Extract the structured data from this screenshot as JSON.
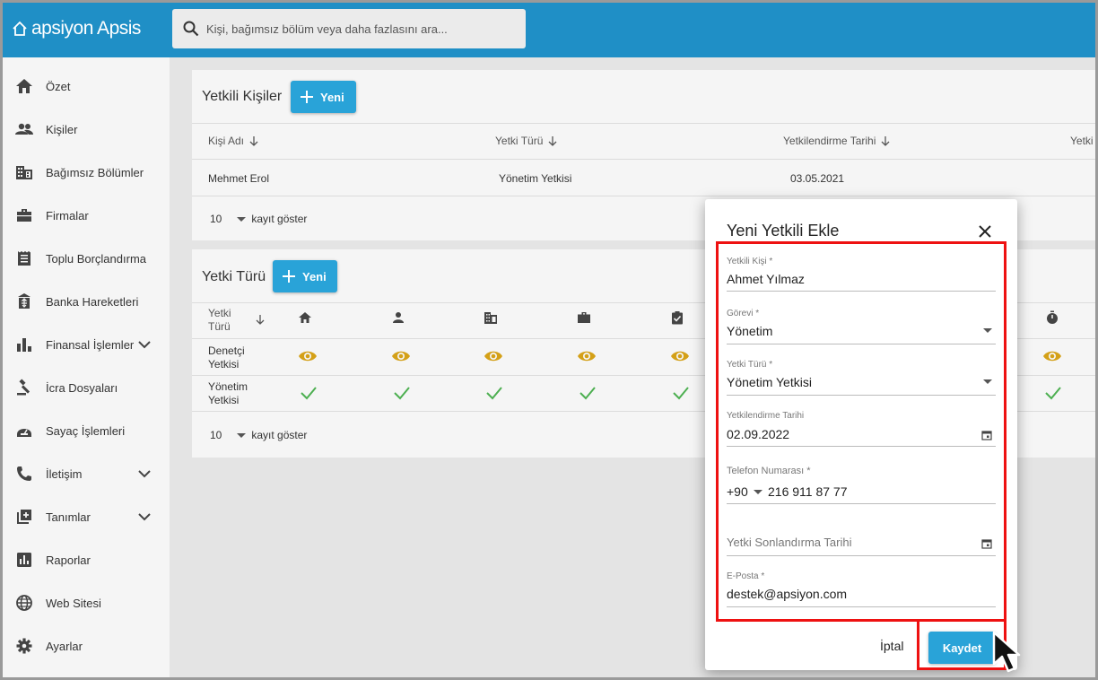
{
  "header": {
    "logo_text": "apsiyon Apsis",
    "search_placeholder": "Kişi, bağımsız bölüm veya daha fazlasını ara...",
    "color": "#1f8fc6"
  },
  "sidebar": {
    "items": [
      {
        "label": "Özet",
        "icon": "home-icon"
      },
      {
        "label": "Kişiler",
        "icon": "people-icon"
      },
      {
        "label": "Bağımsız Bölümler",
        "icon": "building-icon"
      },
      {
        "label": "Firmalar",
        "icon": "briefcase-icon"
      },
      {
        "label": "Toplu Borçlandırma",
        "icon": "receipt-icon"
      },
      {
        "label": "Banka Hareketleri",
        "icon": "bank-transfer-icon"
      },
      {
        "label": "Finansal İşlemler",
        "icon": "bar-chart-icon",
        "expandable": true
      },
      {
        "label": "İcra Dosyaları",
        "icon": "gavel-icon"
      },
      {
        "label": "Sayaç İşlemleri",
        "icon": "meter-icon"
      },
      {
        "label": "İletişim",
        "icon": "phone-icon",
        "expandable": true
      },
      {
        "label": "Tanımlar",
        "icon": "library-add-icon",
        "expandable": true
      },
      {
        "label": "Raporlar",
        "icon": "report-icon"
      },
      {
        "label": "Web Sitesi",
        "icon": "globe-icon"
      },
      {
        "label": "Ayarlar",
        "icon": "gear-icon"
      }
    ]
  },
  "yetkili": {
    "title": "Yetkili Kişiler",
    "new_label": "Yeni",
    "columns": [
      "Kişi Adı",
      "Yetki Türü",
      "Yetkilendirme Tarihi",
      "Yetki"
    ],
    "rows": [
      {
        "name": "Mehmet Erol",
        "type": "Yönetim Yetkisi",
        "date": "03.05.2021"
      }
    ],
    "page_size": "10",
    "page_label": "kayıt göster"
  },
  "yetki_turu": {
    "title": "Yetki Türü",
    "new_label": "Yeni",
    "col_header": "Yetki Türü",
    "col_icons": [
      "home-icon",
      "person-icon",
      "building-icon",
      "briefcase-icon",
      "clipboard-check-icon",
      "stopwatch-icon"
    ],
    "rows": [
      {
        "label": "Denetçi Yetkisi",
        "perm": "view"
      },
      {
        "label": "Yönetim Yetkisi",
        "perm": "edit"
      }
    ],
    "page_size": "10",
    "page_label": "kayıt göster",
    "eye_color": "#d4a017",
    "check_color": "#4caf50"
  },
  "modal": {
    "title": "Yeni Yetkili Ekle",
    "fields": {
      "person_label": "Yetkili Kişi *",
      "person_value": "Ahmet Yılmaz",
      "role_label": "Görevi *",
      "role_value": "Yönetim",
      "type_label": "Yetki Türü *",
      "type_value": "Yönetim Yetkisi",
      "date_label": "Yetkilendirme Tarihi",
      "date_value": "02.09.2022",
      "phone_label": "Telefon Numarası *",
      "phone_code": "+90",
      "phone_value": "216 911 87 77",
      "end_date_placeholder": "Yetki Sonlandırma Tarihi",
      "email_label": "E-Posta *",
      "email_value": "destek@apsiyon.com"
    },
    "cancel_label": "İptal",
    "save_label": "Kaydet",
    "highlight_color": "#ee1111"
  }
}
